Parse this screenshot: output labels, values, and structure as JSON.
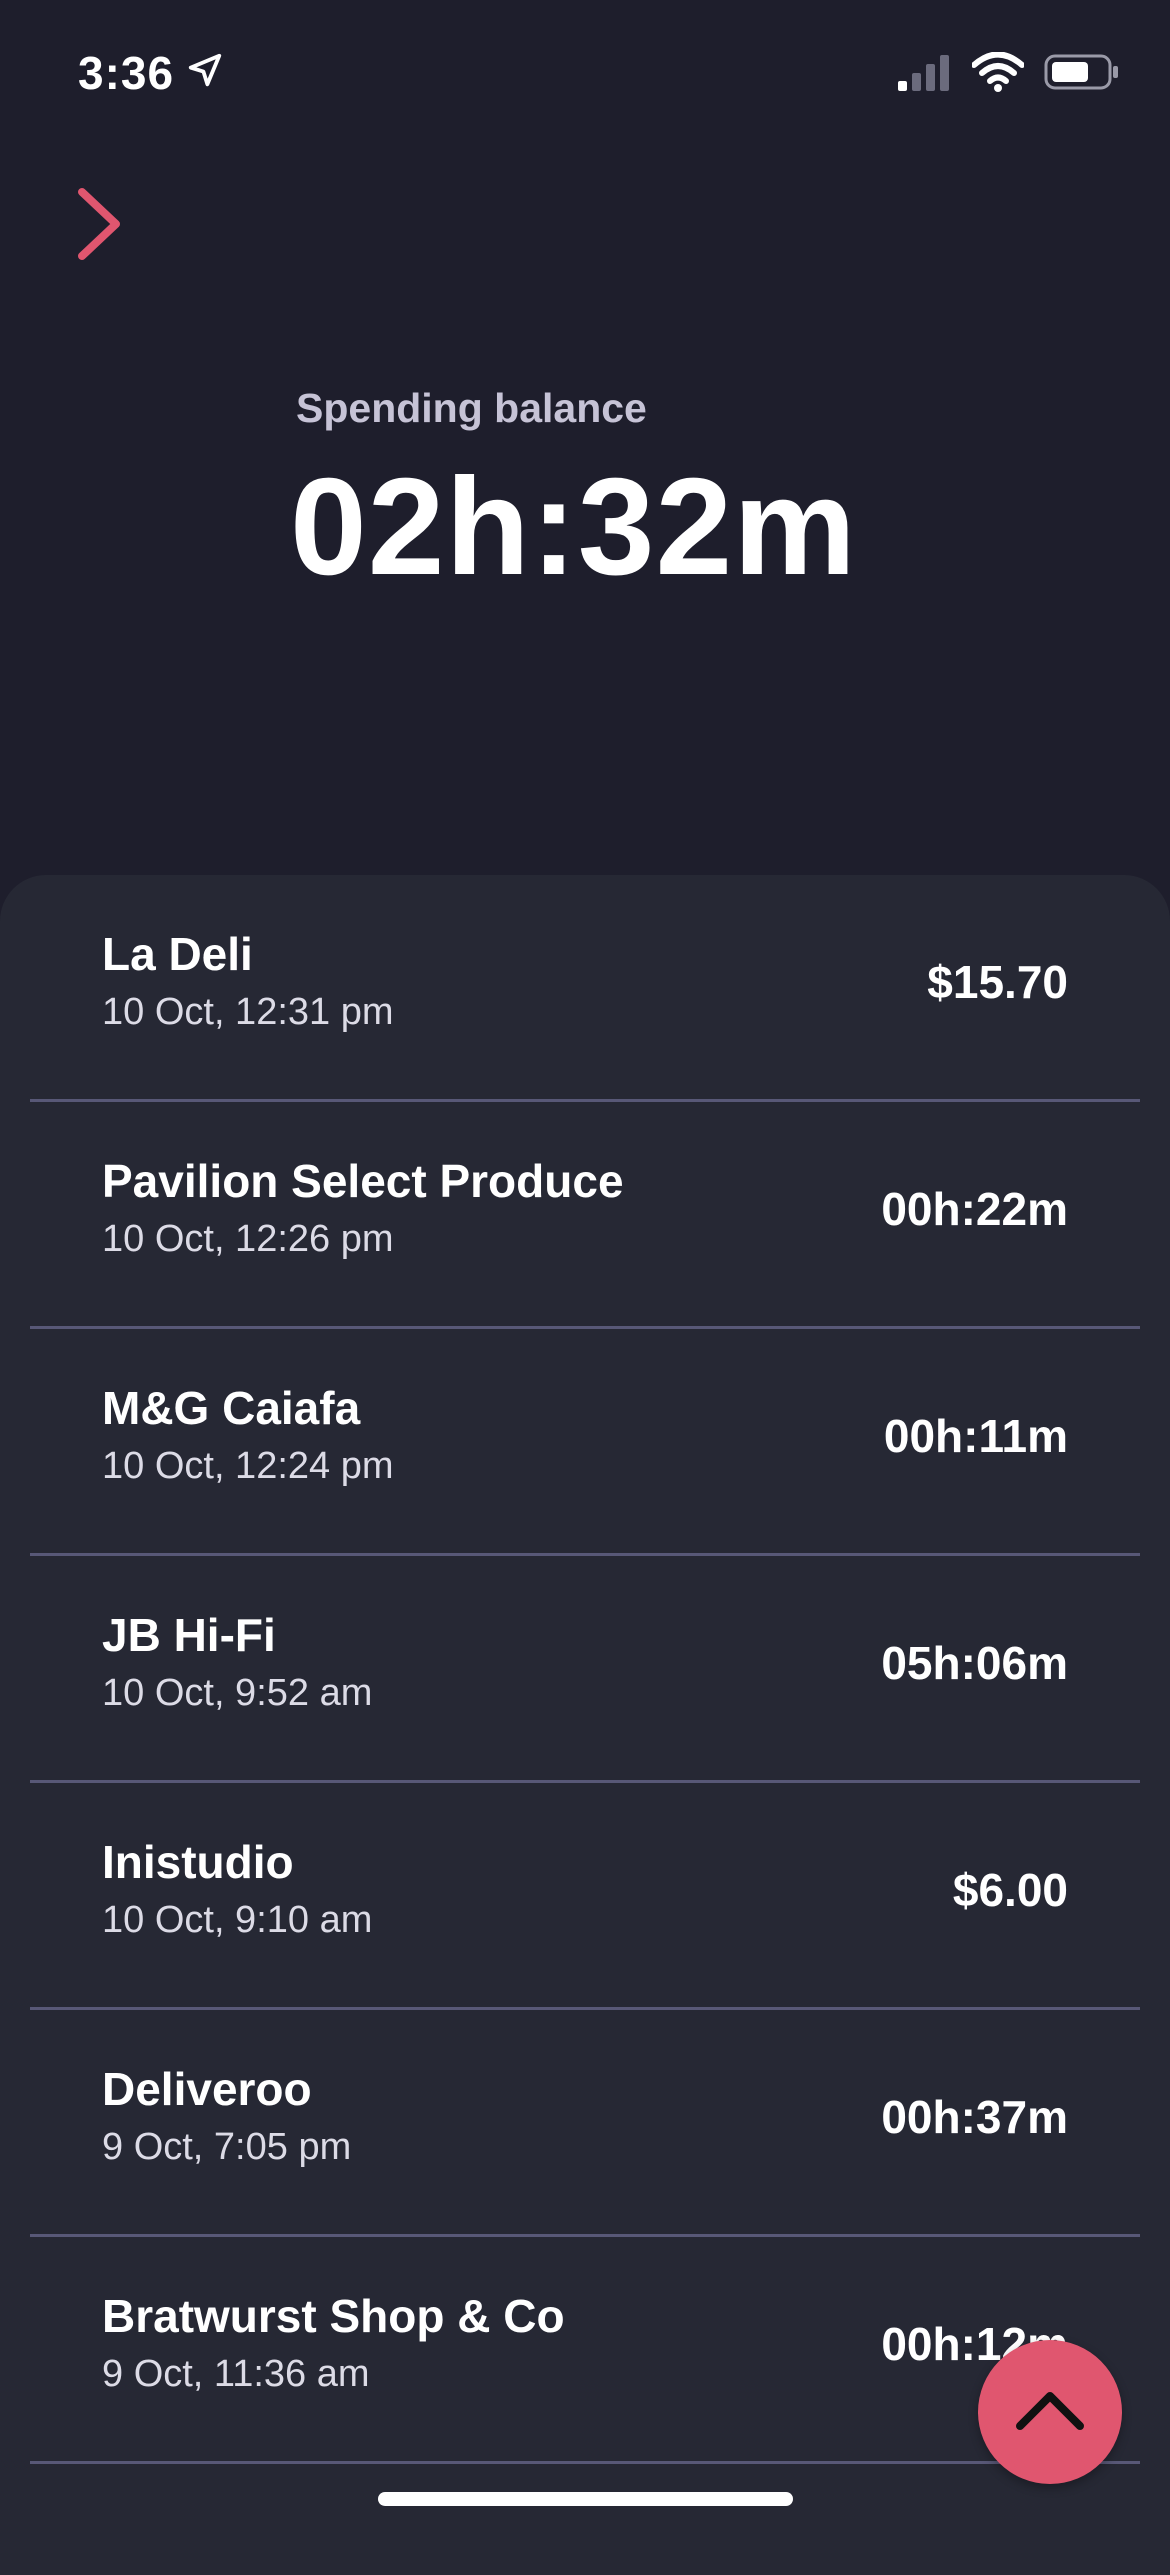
{
  "status_bar": {
    "time": "3:36",
    "icons": [
      "location-arrow-icon",
      "cellular-signal-icon",
      "wifi-icon",
      "battery-icon"
    ]
  },
  "header": {
    "back_icon": "chevron-right-icon",
    "balance_label": "Spending balance",
    "balance_value": "02h:32m"
  },
  "colors": {
    "accent": "#e0566f",
    "background": "#1e1e2c",
    "card": "#262834",
    "divider": "#585877"
  },
  "transactions": [
    {
      "merchant": "La Deli",
      "date": "10 Oct, 12:31 pm",
      "amount": "$15.70"
    },
    {
      "merchant": "Pavilion Select Produce",
      "date": "10 Oct, 12:26 pm",
      "amount": "00h:22m"
    },
    {
      "merchant": "M&G Caiafa",
      "date": "10 Oct, 12:24 pm",
      "amount": "00h:11m"
    },
    {
      "merchant": "JB Hi-Fi",
      "date": "10 Oct, 9:52 am",
      "amount": "05h:06m"
    },
    {
      "merchant": "Inistudio",
      "date": "10 Oct, 9:10 am",
      "amount": "$6.00"
    },
    {
      "merchant": "Deliveroo",
      "date": "9 Oct, 7:05 pm",
      "amount": "00h:37m"
    },
    {
      "merchant": "Bratwurst Shop & Co",
      "date": "9 Oct, 11:36 am",
      "amount": "00h:12m"
    }
  ],
  "fab": {
    "icon": "chevron-up-icon"
  }
}
